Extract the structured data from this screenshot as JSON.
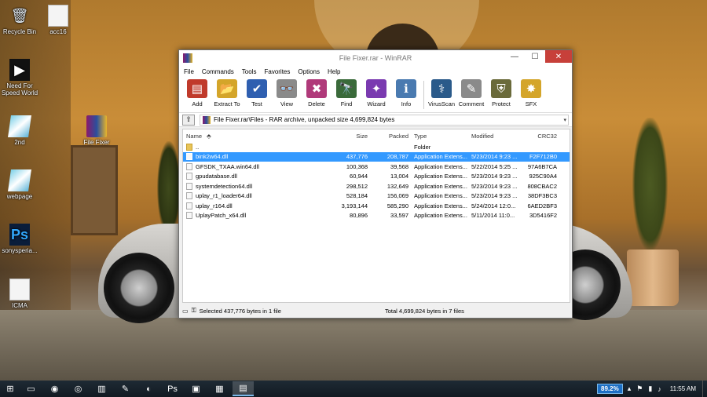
{
  "desktop_icons": [
    {
      "label": "Recycle Bin",
      "icon": "recycle-bin-icon"
    },
    {
      "label": "acc16",
      "icon": "document-icon"
    },
    {
      "label": "Need For Speed World",
      "icon": "game-icon"
    },
    {
      "label": "2nd",
      "icon": "gem-icon"
    },
    {
      "label": "File Fixer",
      "icon": "winrar-archive-icon"
    },
    {
      "label": "webpage",
      "icon": "gem-icon"
    },
    {
      "label": "sonysperia...",
      "icon": "photoshop-file-icon"
    },
    {
      "label": "ICMA",
      "icon": "document-icon"
    }
  ],
  "window": {
    "title": "File Fixer.rar - WinRAR",
    "menu": [
      "File",
      "Commands",
      "Tools",
      "Favorites",
      "Options",
      "Help"
    ],
    "toolbar": [
      {
        "label": "Add",
        "icon": "add-icon",
        "color": "#c03a2b"
      },
      {
        "label": "Extract To",
        "icon": "extract-icon",
        "color": "#d4a52a"
      },
      {
        "label": "Test",
        "icon": "test-icon",
        "color": "#2f5fb0"
      },
      {
        "label": "View",
        "icon": "view-icon",
        "color": "#8a8a8a"
      },
      {
        "label": "Delete",
        "icon": "delete-icon",
        "color": "#b03a7a"
      },
      {
        "label": "Find",
        "icon": "find-icon",
        "color": "#3a6a3a"
      },
      {
        "label": "Wizard",
        "icon": "wizard-icon",
        "color": "#7a3ab0"
      },
      {
        "label": "Info",
        "icon": "info-icon",
        "color": "#4a7ab0"
      },
      {
        "label": "VirusScan",
        "icon": "virusscan-icon",
        "color": "#2a5a8a"
      },
      {
        "label": "Comment",
        "icon": "comment-icon",
        "color": "#8a8a8a"
      },
      {
        "label": "Protect",
        "icon": "protect-icon",
        "color": "#6a6a3a"
      },
      {
        "label": "SFX",
        "icon": "sfx-icon",
        "color": "#d4a52a"
      }
    ],
    "address": "File Fixer.rar\\Files - RAR archive, unpacked size 4,699,824 bytes",
    "columns": {
      "name": "Name",
      "size": "Size",
      "packed": "Packed",
      "type": "Type",
      "modified": "Modified",
      "crc": "CRC32"
    },
    "files": [
      {
        "name": "..",
        "size": "",
        "packed": "",
        "type": "Folder",
        "modified": "",
        "crc": "",
        "folder": true
      },
      {
        "name": "bink2w64.dll",
        "size": "437,776",
        "packed": "208,787",
        "type": "Application Extens...",
        "modified": "5/23/2014 9:23 ...",
        "crc": "F2F712B0",
        "selected": true
      },
      {
        "name": "GFSDK_TXAA.win64.dll",
        "size": "100,368",
        "packed": "39,568",
        "type": "Application Extens...",
        "modified": "5/22/2014 5:25 ...",
        "crc": "97A6B7CA"
      },
      {
        "name": "gpudatabase.dll",
        "size": "60,944",
        "packed": "13,004",
        "type": "Application Extens...",
        "modified": "5/23/2014 9:23 ...",
        "crc": "925C90A4"
      },
      {
        "name": "systemdetection64.dll",
        "size": "298,512",
        "packed": "132,649",
        "type": "Application Extens...",
        "modified": "5/23/2014 9:23 ...",
        "crc": "808CBAC2"
      },
      {
        "name": "uplay_r1_loader64.dll",
        "size": "528,184",
        "packed": "156,069",
        "type": "Application Extens...",
        "modified": "5/23/2014 9:23 ...",
        "crc": "38DF3BC3"
      },
      {
        "name": "uplay_r164.dll",
        "size": "3,193,144",
        "packed": "585,290",
        "type": "Application Extens...",
        "modified": "5/24/2014 12:0...",
        "crc": "6AED2BF3"
      },
      {
        "name": "UplayPatch_x64.dll",
        "size": "80,896",
        "packed": "33,597",
        "type": "Application Extens...",
        "modified": "5/11/2014 11:0...",
        "crc": "3D5416F2"
      }
    ],
    "status_left": "Selected 437,776 bytes in 1 file",
    "status_right": "Total 4,699,824 bytes in 7 files"
  },
  "taskbar": {
    "items": [
      "windows-icon",
      "explorer-icon",
      "firefox-icon",
      "chrome-icon",
      "folder-icon",
      "pdf-icon",
      "greenshot-icon",
      "photoshop-icon",
      "app-icon",
      "excel-icon",
      "winrar-icon"
    ],
    "battery": "89.2%",
    "clock": "11:55 AM"
  }
}
